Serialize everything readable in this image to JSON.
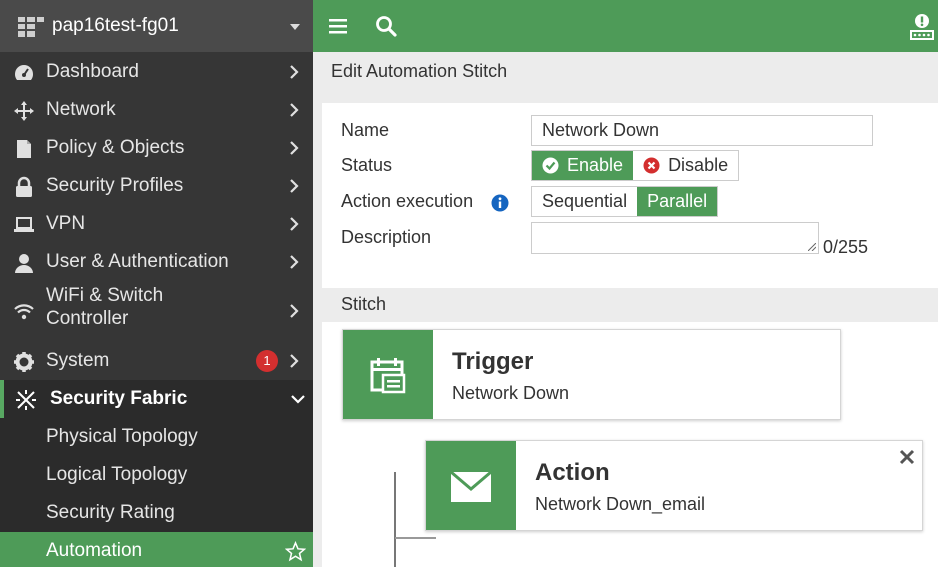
{
  "app": {
    "hostname": "pap16test-fg01"
  },
  "sidebar": {
    "items": [
      {
        "label": "Dashboard",
        "icon": "dashboard-icon"
      },
      {
        "label": "Network",
        "icon": "network-icon"
      },
      {
        "label": "Policy & Objects",
        "icon": "policy-icon"
      },
      {
        "label": "Security Profiles",
        "icon": "lock-icon"
      },
      {
        "label": "VPN",
        "icon": "laptop-icon"
      },
      {
        "label": "User & Authentication",
        "icon": "user-icon"
      },
      {
        "label": "WiFi & Switch Controller",
        "icon": "wifi-icon"
      },
      {
        "label": "System",
        "icon": "gear-icon",
        "badge": "1"
      },
      {
        "label": "Security Fabric",
        "icon": "fabric-icon",
        "expanded": true
      }
    ],
    "subitems": [
      {
        "label": "Physical Topology"
      },
      {
        "label": "Logical Topology"
      },
      {
        "label": "Security Rating"
      },
      {
        "label": "Automation",
        "active": true
      }
    ]
  },
  "topbar": {
    "icons": [
      "menu-icon",
      "search-icon",
      "alert-icon"
    ]
  },
  "page": {
    "title": "Edit Automation Stitch"
  },
  "form": {
    "name_label": "Name",
    "name_value": "Network Down",
    "status_label": "Status",
    "status_enable": "Enable",
    "status_disable": "Disable",
    "status_selected": "Enable",
    "exec_label": "Action execution",
    "exec_sequential": "Sequential",
    "exec_parallel": "Parallel",
    "exec_selected": "Parallel",
    "desc_label": "Description",
    "desc_value": "",
    "desc_counter": "0/255"
  },
  "stitch": {
    "section_label": "Stitch",
    "trigger": {
      "title": "Trigger",
      "subtitle": "Network Down",
      "icon": "calendar-event-icon"
    },
    "action": {
      "title": "Action",
      "subtitle": "Network Down_email",
      "icon": "envelope-icon"
    }
  },
  "colors": {
    "accent": "#4e9b58",
    "sidebar_bg": "#363636",
    "sidebar_header": "#4a4a4a",
    "badge": "#d32f2f",
    "disable_icon": "#d32f2f",
    "info_icon": "#1565c0"
  }
}
